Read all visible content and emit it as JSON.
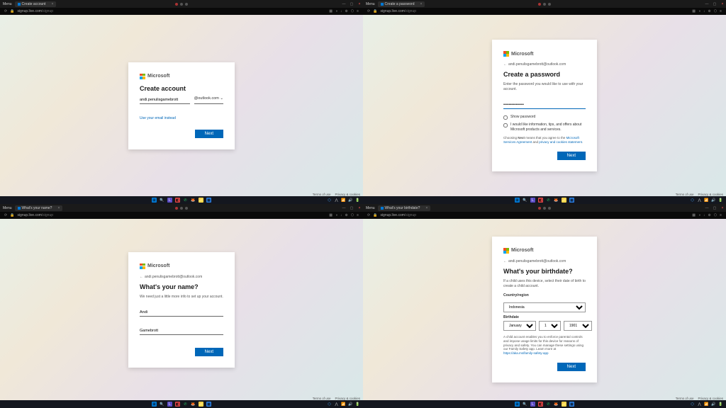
{
  "common": {
    "menu": "Menu",
    "microsoft": "Microsoft",
    "url_host": "signup.live.com",
    "url_path": "/signup",
    "next": "Next",
    "terms": "Terms of use",
    "privacy": "Privacy & cookies",
    "email": "andi.penulisgamebrott@outlook.com"
  },
  "q1": {
    "tab": "Create account",
    "title": "Create account",
    "email_local": "andi.penulisgamebrott",
    "domain": "@outlook.com ⌄",
    "link": "Use your email instead"
  },
  "q2": {
    "tab": "Create a password",
    "title": "Create a password",
    "sub": "Enter the password you would like to use with your account.",
    "pw": "•••••••••••••••",
    "show_pw": "Show password",
    "offers": "I would like information, tips, and offers about Microsoft products and services.",
    "fine_pre": "Choosing ",
    "fine_bold": "Next",
    "fine_mid": " means that you agree to the ",
    "msa": "Microsoft Services Agreement",
    "and": " and ",
    "pcs": "privacy and cookies statement"
  },
  "q3": {
    "tab": "What's your name?",
    "title": "What's your name?",
    "sub": "We need just a little more info to set up your account.",
    "first": "Andi",
    "last": "Gamebrott"
  },
  "q4": {
    "tab": "What's your birthdate?",
    "title": "What's your birthdate?",
    "sub": "If a child uses this device, select their date of birth to create a child account.",
    "cr_lbl": "Country/region",
    "country": "Indonesia",
    "bd_lbl": "Birthdate",
    "month": "January",
    "day": "1",
    "year": "1901",
    "fine": "A child account enables you to enforce parental controls and impose usage limits for this device for reasons of privacy and safety. You can manage these settings using our Family Safety app. Learn more at ",
    "fine_link": "https://aka.ms/family-safety-app"
  }
}
